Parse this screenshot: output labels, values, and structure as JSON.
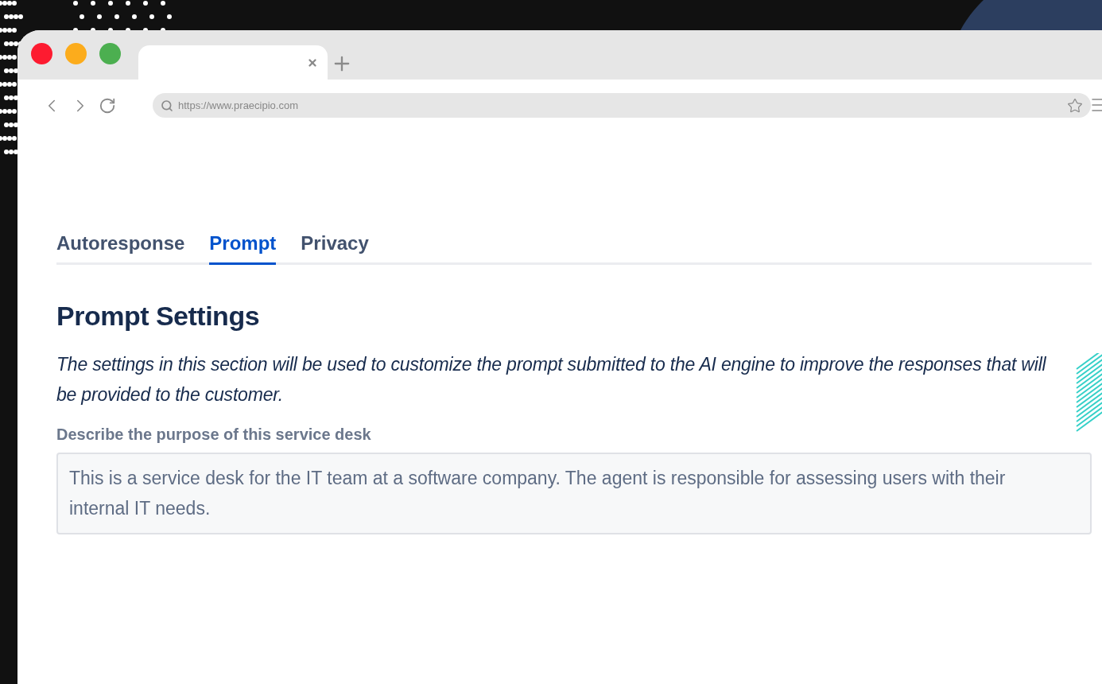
{
  "browser": {
    "url": "https://www.praecipio.com"
  },
  "tabs": [
    {
      "label": "Autoresponse",
      "selected": false
    },
    {
      "label": "Prompt",
      "selected": true
    },
    {
      "label": "Privacy",
      "selected": false
    }
  ],
  "heading": "Prompt Settings",
  "description": "The settings in this section will be used to customize the prompt submitted to the AI engine to improve the responses that will be provided to the customer.",
  "field": {
    "label": "Describe the purpose of this service desk",
    "value": "This is a service desk for the IT team at a software company. The agent is responsible for assessing users with their internal IT needs."
  }
}
